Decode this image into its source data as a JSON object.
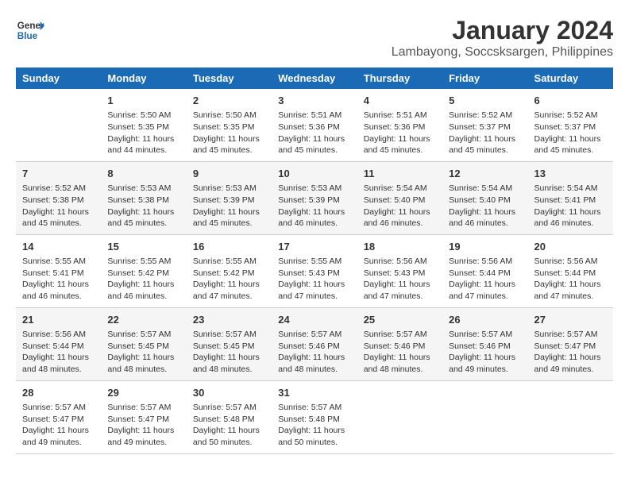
{
  "header": {
    "logo_line1": "General",
    "logo_line2": "Blue",
    "title": "January 2024",
    "subtitle": "Lambayong, Soccsksargen, Philippines"
  },
  "days_of_week": [
    "Sunday",
    "Monday",
    "Tuesday",
    "Wednesday",
    "Thursday",
    "Friday",
    "Saturday"
  ],
  "weeks": [
    [
      {
        "day": "",
        "content": ""
      },
      {
        "day": "1",
        "content": "Sunrise: 5:50 AM\nSunset: 5:35 PM\nDaylight: 11 hours\nand 44 minutes."
      },
      {
        "day": "2",
        "content": "Sunrise: 5:50 AM\nSunset: 5:35 PM\nDaylight: 11 hours\nand 45 minutes."
      },
      {
        "day": "3",
        "content": "Sunrise: 5:51 AM\nSunset: 5:36 PM\nDaylight: 11 hours\nand 45 minutes."
      },
      {
        "day": "4",
        "content": "Sunrise: 5:51 AM\nSunset: 5:36 PM\nDaylight: 11 hours\nand 45 minutes."
      },
      {
        "day": "5",
        "content": "Sunrise: 5:52 AM\nSunset: 5:37 PM\nDaylight: 11 hours\nand 45 minutes."
      },
      {
        "day": "6",
        "content": "Sunrise: 5:52 AM\nSunset: 5:37 PM\nDaylight: 11 hours\nand 45 minutes."
      }
    ],
    [
      {
        "day": "7",
        "content": "Sunrise: 5:52 AM\nSunset: 5:38 PM\nDaylight: 11 hours\nand 45 minutes."
      },
      {
        "day": "8",
        "content": "Sunrise: 5:53 AM\nSunset: 5:38 PM\nDaylight: 11 hours\nand 45 minutes."
      },
      {
        "day": "9",
        "content": "Sunrise: 5:53 AM\nSunset: 5:39 PM\nDaylight: 11 hours\nand 45 minutes."
      },
      {
        "day": "10",
        "content": "Sunrise: 5:53 AM\nSunset: 5:39 PM\nDaylight: 11 hours\nand 46 minutes."
      },
      {
        "day": "11",
        "content": "Sunrise: 5:54 AM\nSunset: 5:40 PM\nDaylight: 11 hours\nand 46 minutes."
      },
      {
        "day": "12",
        "content": "Sunrise: 5:54 AM\nSunset: 5:40 PM\nDaylight: 11 hours\nand 46 minutes."
      },
      {
        "day": "13",
        "content": "Sunrise: 5:54 AM\nSunset: 5:41 PM\nDaylight: 11 hours\nand 46 minutes."
      }
    ],
    [
      {
        "day": "14",
        "content": "Sunrise: 5:55 AM\nSunset: 5:41 PM\nDaylight: 11 hours\nand 46 minutes."
      },
      {
        "day": "15",
        "content": "Sunrise: 5:55 AM\nSunset: 5:42 PM\nDaylight: 11 hours\nand 46 minutes."
      },
      {
        "day": "16",
        "content": "Sunrise: 5:55 AM\nSunset: 5:42 PM\nDaylight: 11 hours\nand 47 minutes."
      },
      {
        "day": "17",
        "content": "Sunrise: 5:55 AM\nSunset: 5:43 PM\nDaylight: 11 hours\nand 47 minutes."
      },
      {
        "day": "18",
        "content": "Sunrise: 5:56 AM\nSunset: 5:43 PM\nDaylight: 11 hours\nand 47 minutes."
      },
      {
        "day": "19",
        "content": "Sunrise: 5:56 AM\nSunset: 5:44 PM\nDaylight: 11 hours\nand 47 minutes."
      },
      {
        "day": "20",
        "content": "Sunrise: 5:56 AM\nSunset: 5:44 PM\nDaylight: 11 hours\nand 47 minutes."
      }
    ],
    [
      {
        "day": "21",
        "content": "Sunrise: 5:56 AM\nSunset: 5:44 PM\nDaylight: 11 hours\nand 48 minutes."
      },
      {
        "day": "22",
        "content": "Sunrise: 5:57 AM\nSunset: 5:45 PM\nDaylight: 11 hours\nand 48 minutes."
      },
      {
        "day": "23",
        "content": "Sunrise: 5:57 AM\nSunset: 5:45 PM\nDaylight: 11 hours\nand 48 minutes."
      },
      {
        "day": "24",
        "content": "Sunrise: 5:57 AM\nSunset: 5:46 PM\nDaylight: 11 hours\nand 48 minutes."
      },
      {
        "day": "25",
        "content": "Sunrise: 5:57 AM\nSunset: 5:46 PM\nDaylight: 11 hours\nand 48 minutes."
      },
      {
        "day": "26",
        "content": "Sunrise: 5:57 AM\nSunset: 5:46 PM\nDaylight: 11 hours\nand 49 minutes."
      },
      {
        "day": "27",
        "content": "Sunrise: 5:57 AM\nSunset: 5:47 PM\nDaylight: 11 hours\nand 49 minutes."
      }
    ],
    [
      {
        "day": "28",
        "content": "Sunrise: 5:57 AM\nSunset: 5:47 PM\nDaylight: 11 hours\nand 49 minutes."
      },
      {
        "day": "29",
        "content": "Sunrise: 5:57 AM\nSunset: 5:47 PM\nDaylight: 11 hours\nand 49 minutes."
      },
      {
        "day": "30",
        "content": "Sunrise: 5:57 AM\nSunset: 5:48 PM\nDaylight: 11 hours\nand 50 minutes."
      },
      {
        "day": "31",
        "content": "Sunrise: 5:57 AM\nSunset: 5:48 PM\nDaylight: 11 hours\nand 50 minutes."
      },
      {
        "day": "",
        "content": ""
      },
      {
        "day": "",
        "content": ""
      },
      {
        "day": "",
        "content": ""
      }
    ]
  ]
}
